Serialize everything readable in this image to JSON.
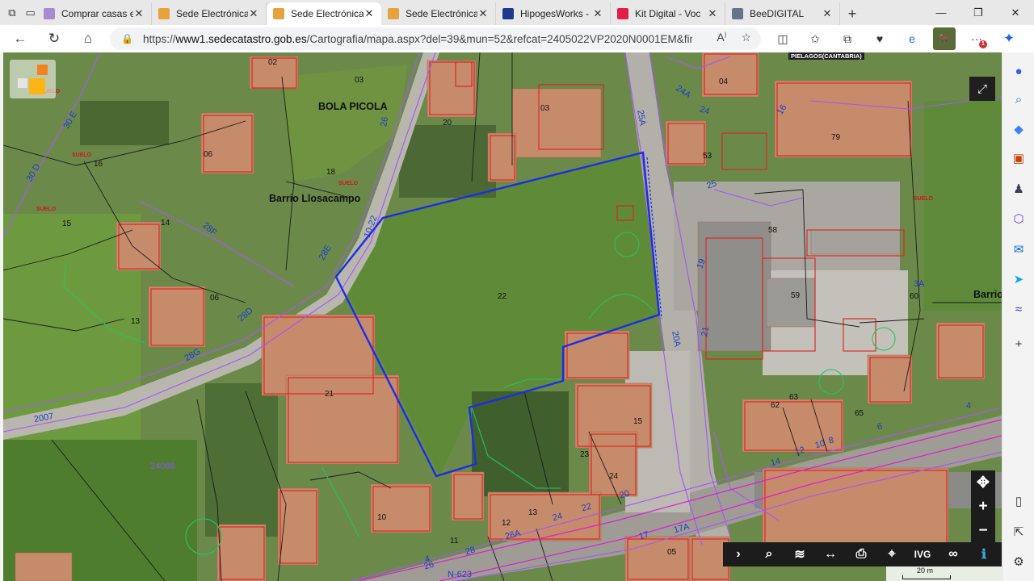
{
  "browser": {
    "tabs": [
      {
        "title": "Comprar casas e",
        "favicon": "#a78bcf",
        "active": false
      },
      {
        "title": "Sede Electrónica",
        "favicon": "#e6a23c",
        "active": false
      },
      {
        "title": "Sede Electrónica",
        "favicon": "#e6a23c",
        "active": true
      },
      {
        "title": "Sede Electrónica",
        "favicon": "#e6a23c",
        "active": false
      },
      {
        "title": "HipogesWorks -",
        "favicon": "#1e3a8a",
        "active": false
      },
      {
        "title": "Kit Digital - Voc",
        "favicon": "#e11d48",
        "active": false
      },
      {
        "title": "BeeDIGITAL",
        "favicon": "#64748b",
        "active": false
      }
    ],
    "url_prefix": "https://",
    "url_host": "www1.sedecatastro.gob.es",
    "url_rest": "/Cartografia/mapa.aspx?del=39&mun=52&refcat=2405022VP2020N0001EM&fina...",
    "extension_badge": "1"
  },
  "map": {
    "header_label": "PIELAGOS(CANTABRIA)",
    "scale_label": "20 m",
    "place_labels": [
      {
        "text": "BOLA PICOLA",
        "big": true
      },
      {
        "text": "Barrio Llosacampo",
        "big": true
      },
      {
        "text": "Barrio",
        "big": true
      }
    ],
    "parcel_numbers": [
      "02",
      "03",
      "20",
      "03",
      "04",
      "06",
      "16",
      "18",
      "15",
      "14",
      "06",
      "13",
      "22",
      "58",
      "59",
      "60",
      "21",
      "15",
      "23",
      "24",
      "10",
      "11",
      "12",
      "13",
      "62",
      "63",
      "65",
      "05",
      "79",
      "53"
    ],
    "street_numbers": [
      "30 E",
      "30 D",
      "26",
      "24A",
      "24",
      "25A",
      "25",
      "4",
      "28F",
      "28E",
      "10-22",
      "28D",
      "28G",
      "2007",
      "19",
      "20A",
      "21",
      "16",
      "3A",
      "14",
      "12",
      "10",
      "8",
      "6",
      "4",
      "26",
      "28",
      "26A",
      "24",
      "22",
      "20",
      "17",
      "17A",
      "N-623"
    ],
    "other_labels": [
      "SUELO",
      "SUELO",
      "SUELO",
      "SUELO",
      "SUELO",
      "24088"
    ],
    "bottom_tools": [
      {
        "icon": "chevron-right-icon",
        "glyph": "›"
      },
      {
        "icon": "search-icon",
        "glyph": "⌕"
      },
      {
        "icon": "layers-icon",
        "glyph": "≋"
      },
      {
        "icon": "measure-icon",
        "glyph": "↔"
      },
      {
        "icon": "print-icon",
        "glyph": "⎙"
      },
      {
        "icon": "coordinates-icon",
        "glyph": "⌖"
      },
      {
        "text": "IVG"
      },
      {
        "icon": "binoculars-icon",
        "glyph": "∞"
      },
      {
        "icon": "info-icon",
        "glyph": "ℹ"
      }
    ]
  }
}
